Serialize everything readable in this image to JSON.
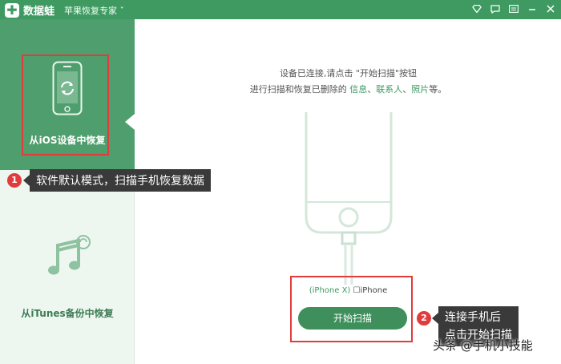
{
  "titlebar": {
    "app_name": "数据蛙",
    "product": "苹果恢复专家 ˇ",
    "icons": [
      "diamond-icon",
      "chat-icon",
      "menu-icon",
      "minimize-icon",
      "close-icon"
    ]
  },
  "sidebar": {
    "items": [
      {
        "label": "从iOS设备中恢复",
        "icon": "phone-refresh-icon",
        "active": true
      },
      {
        "label": "从iTunes备份中恢复",
        "icon": "music-sync-icon",
        "active": false
      }
    ]
  },
  "main": {
    "instruction_line1": "设备已连接,请点击 \"开始扫描\"按钮",
    "instruction_line2_prefix": "进行扫描和恢复已删除的 ",
    "instruction_hl1": "信息",
    "instruction_sep1": "、",
    "instruction_hl2": "联系人",
    "instruction_sep2": "、",
    "instruction_hl3": "照片",
    "instruction_suffix": "等。",
    "device_model": "(iPhone X)",
    "device_name": "iPhone",
    "start_button": "开始扫描"
  },
  "annotations": {
    "badge1": "1",
    "tip1": "软件默认模式，扫描手机恢复数据",
    "badge2": "2",
    "tip2_line1": "连接手机后",
    "tip2_line2": "点击开始扫描"
  },
  "watermark": "头条 @手机小技能",
  "colors": {
    "brand": "#3f9a62",
    "sidebar_active": "#4f9e6d",
    "highlight": "#e23b3b",
    "button": "#3f8f5c"
  }
}
